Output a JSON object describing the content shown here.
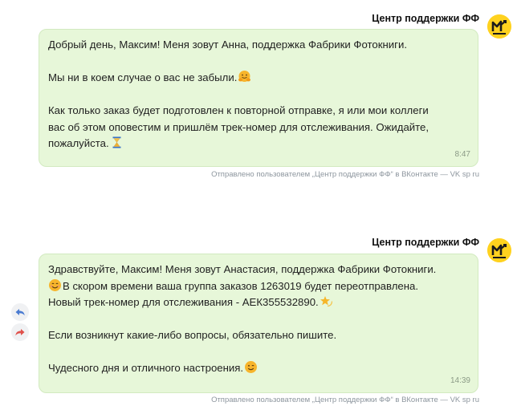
{
  "messages": [
    {
      "sender": "Центр поддержки ФФ",
      "lines": [
        "Добрый день, Максим! Меня зовут Анна, поддержка Фабрики Фотокниги.",
        "",
        "Мы ни в коем случае о вас не забыли.",
        "",
        "Как только заказ будет подготовлен к повторной отправке, я или мои коллеги",
        "вас об этом оповестим и пришлём трек-номер для отслеживания. Ожидайте,",
        "пожалуйста."
      ],
      "time": "8:47",
      "footnote": "Отправлено пользователем „Центр поддержки ФФ“ в ВКонтакте — VK sp ru"
    },
    {
      "sender": "Центр поддержки ФФ",
      "lines": [
        "Здравствуйте, Максим! Меня зовут Анастасия, поддержка Фабрики Фотокниги.",
        "В скором времени ваша группа заказов 1263019 будет переотправлена.",
        "Новый трек-номер для отслеживания - АЕК355532890.",
        "",
        "Если возникнут какие-либо вопросы, обязательно пишите.",
        "",
        "Чудесного дня и отличного настроения."
      ],
      "time": "14:39",
      "footnote": "Отправлено пользователем „Центр поддержки ФФ“ в ВКонтакте — VK sp ru"
    }
  ],
  "side_actions": {
    "reply_icon": "reply-arrow-icon",
    "forward_icon": "forward-arrow-icon"
  },
  "colors": {
    "bubble_bg": "#e7f7d9",
    "bubble_border": "#d2eac0",
    "avatar_bg": "#ffd21f",
    "reply_icon": "#4a7bd1",
    "forward_icon": "#e0514b"
  }
}
